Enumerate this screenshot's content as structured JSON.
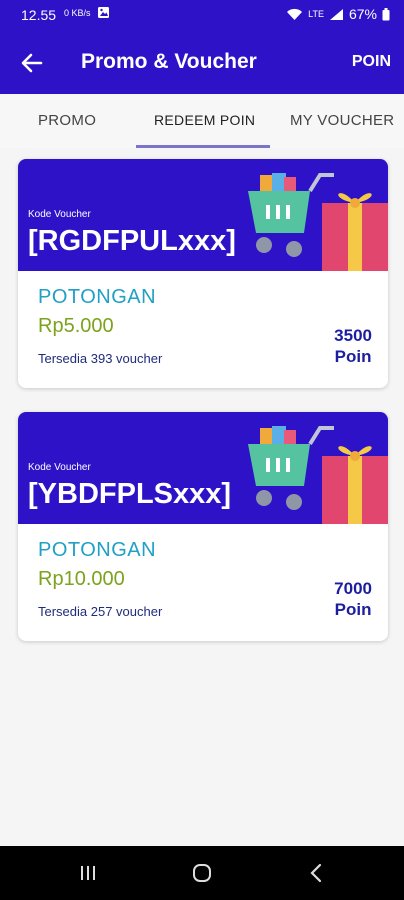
{
  "status_bar": {
    "time": "12.55",
    "data_speed": "0 KB/s",
    "battery_percent": "67%"
  },
  "app_bar": {
    "title": "Promo & Voucher",
    "action_label": "POIN",
    "back_icon": "arrow-left-icon"
  },
  "tabs": [
    {
      "label": "PROMO",
      "active": false
    },
    {
      "label": "REDEEM POIN",
      "active": true
    },
    {
      "label": "MY VOUCHER",
      "active": false
    }
  ],
  "vouchers": [
    {
      "kode_label": "Kode Voucher",
      "kode": "[RGDFPULxxx]",
      "type": "POTONGAN",
      "amount": "Rp5.000",
      "stock": "Tersedia 393 voucher",
      "points_value": "3500",
      "points_unit": "Poin"
    },
    {
      "kode_label": "Kode Voucher",
      "kode": "[YBDFPLSxxx]",
      "type": "POTONGAN",
      "amount": "Rp10.000",
      "stock": "Tersedia 257 voucher",
      "points_value": "7000",
      "points_unit": "Poin"
    }
  ],
  "colors": {
    "primary": "#2d12c8",
    "potongan": "#21a0c6",
    "amount": "#7ca21e",
    "points": "#1c1ea0"
  }
}
